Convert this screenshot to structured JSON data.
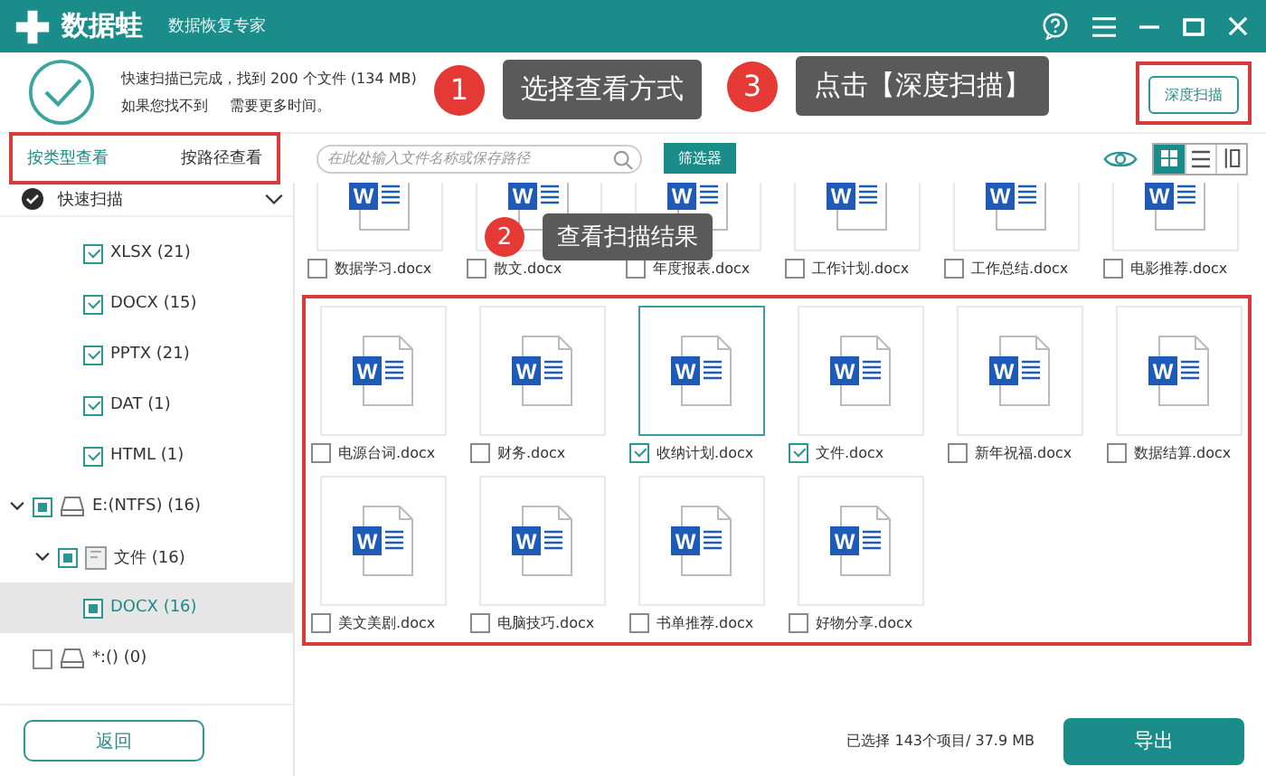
{
  "titlebar": {
    "app_name": "数据蛙",
    "subtitle": "数据恢复专家"
  },
  "scan_summary": {
    "line1": "快速扫描已完成，找到 200 个文件 (134 MB)",
    "line2_start": "如果您找不到",
    "line2_end": "需要更多时间。"
  },
  "deep_scan_button": "深度扫描",
  "view_tabs": [
    {
      "label": "按类型查看",
      "selected": true
    },
    {
      "label": "按路径查看",
      "selected": false
    }
  ],
  "search": {
    "placeholder": "在此处输入文件名称或保存路径"
  },
  "filter_button": "筛选器",
  "view_modes": [
    {
      "kind": "grid",
      "selected": true
    },
    {
      "kind": "list",
      "selected": false
    },
    {
      "kind": "detail",
      "selected": false
    }
  ],
  "sidebar": {
    "root": {
      "label": "快速扫描",
      "expanded": true
    },
    "type_items": [
      {
        "label": "XLSX (21)",
        "checked": true,
        "selected": false
      },
      {
        "label": "DOCX (15)",
        "checked": true,
        "selected": false
      },
      {
        "label": "PPTX (21)",
        "checked": true,
        "selected": false
      },
      {
        "label": "DAT (1)",
        "checked": true,
        "selected": false
      },
      {
        "label": "HTML (1)",
        "checked": true,
        "selected": false
      }
    ],
    "tree": [
      {
        "kind": "drive",
        "label": "E:(NTFS) (16)",
        "partial": true,
        "expanded": true,
        "selected": false,
        "children": [
          {
            "kind": "folder",
            "label": "文件 (16)",
            "partial": true,
            "expanded": true,
            "selected": false,
            "children": [
              {
                "label": "DOCX (16)",
                "partial": true,
                "selected": true
              }
            ]
          }
        ]
      },
      {
        "kind": "drive",
        "label": "*:() (0)",
        "partial": false,
        "selected": false
      }
    ],
    "back_button": "返回"
  },
  "file_rows": [
    [
      {
        "name": "数据学习.docx",
        "icon_letter": "W",
        "checked": false,
        "selected": false
      },
      {
        "name": "散文.docx",
        "icon_letter": "W",
        "checked": false,
        "selected": false
      },
      {
        "name": "年度报表.docx",
        "icon_letter": "W",
        "checked": false,
        "selected": false
      },
      {
        "name": "工作计划.docx",
        "icon_letter": "W",
        "checked": false,
        "selected": false
      },
      {
        "name": "工作总结.docx",
        "icon_letter": "W",
        "checked": false,
        "selected": false
      },
      {
        "name": "电影推荐.docx",
        "icon_letter": "W",
        "checked": false,
        "selected": false
      }
    ],
    [
      {
        "name": "电源台词.docx",
        "icon_letter": "W",
        "checked": false,
        "selected": false
      },
      {
        "name": "财务.docx",
        "icon_letter": "W",
        "checked": false,
        "selected": false
      },
      {
        "name": "收纳计划.docx",
        "icon_letter": "W",
        "checked": true,
        "selected": true
      },
      {
        "name": "文件.docx",
        "icon_letter": "W",
        "checked": true,
        "selected": false
      },
      {
        "name": "新年祝福.docx",
        "icon_letter": "W",
        "checked": false,
        "selected": false
      },
      {
        "name": "数据结算.docx",
        "icon_letter": "W",
        "checked": false,
        "selected": false
      }
    ],
    [
      {
        "name": "美文美剧.docx",
        "icon_letter": "W",
        "checked": false,
        "selected": false
      },
      {
        "name": "电脑技巧.docx",
        "icon_letter": "W",
        "checked": false,
        "selected": false
      },
      {
        "name": "书单推荐.docx",
        "icon_letter": "W",
        "checked": false,
        "selected": false
      },
      {
        "name": "好物分享.docx",
        "icon_letter": "W",
        "checked": false,
        "selected": false
      }
    ]
  ],
  "footer": {
    "selection_info": "已选择 143个项目/ 37.9 MB",
    "export_button": "导出"
  },
  "callouts": [
    {
      "number": "1",
      "text": "选择查看方式"
    },
    {
      "number": "2",
      "text": "查看扫描结果"
    },
    {
      "number": "3",
      "text": "点击【深度扫描】"
    }
  ]
}
